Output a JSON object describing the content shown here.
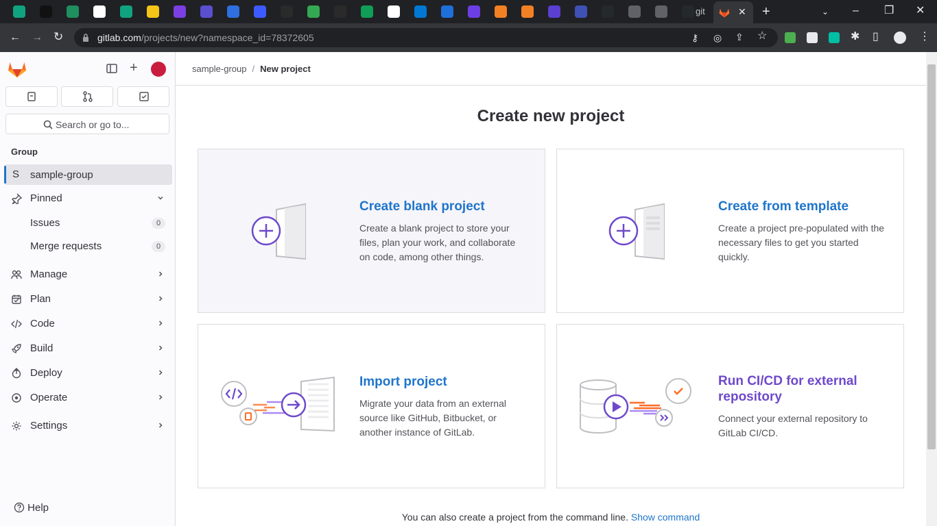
{
  "browser": {
    "url_domain": "gitlab.com",
    "url_path": "/projects/new?namespace_id=78372605",
    "active_tab_title": "git",
    "tab_colors": [
      "#10a37f",
      "#111111",
      "#1f8f5f",
      "#ffffff",
      "#10a37f",
      "#f5c518",
      "#7b3fe4",
      "#5a4fcf",
      "#2f6fdf",
      "#3d5afe",
      "#2a2a2a",
      "#34a853",
      "#2a2a2a",
      "#0f9d58",
      "#ffffff",
      "#0078d4",
      "#1e6fd9",
      "#6b3fe4",
      "#f48024",
      "#f48024",
      "#5b3fd0",
      "#3f51b5",
      "#24292e",
      "#5f6368",
      "#5f6368",
      "#24292e"
    ]
  },
  "sidebar": {
    "search_label": "Search or go to...",
    "group_header": "Group",
    "group": {
      "initial": "S",
      "name": "sample-group"
    },
    "pinned": {
      "label": "Pinned",
      "items": [
        {
          "label": "Issues",
          "count": "0"
        },
        {
          "label": "Merge requests",
          "count": "0"
        }
      ]
    },
    "nav": [
      {
        "label": "Manage",
        "icon": "users-icon"
      },
      {
        "label": "Plan",
        "icon": "calendar-icon"
      },
      {
        "label": "Code",
        "icon": "code-icon"
      },
      {
        "label": "Build",
        "icon": "rocket-icon"
      },
      {
        "label": "Deploy",
        "icon": "deploy-icon"
      },
      {
        "label": "Operate",
        "icon": "operate-icon"
      },
      {
        "label": "Settings",
        "icon": "settings-icon"
      }
    ],
    "help_label": "Help"
  },
  "breadcrumb": {
    "parent": "sample-group",
    "current": "New project"
  },
  "page": {
    "title": "Create new project",
    "cards": [
      {
        "title": "Create blank project",
        "desc": [
          "Create a blank project to store your",
          "files, plan your work, and collaborate",
          "on code, among other things."
        ]
      },
      {
        "title": "Create from template",
        "desc": [
          "Create a project pre-populated with the",
          "necessary files to get you started",
          "quickly."
        ]
      },
      {
        "title": "Import project",
        "desc": [
          "Migrate your data from an external",
          "source like GitHub, Bitbucket, or",
          "another instance of GitLab."
        ]
      },
      {
        "title": [
          "Run CI/CD for external",
          "repository"
        ],
        "desc": [
          "Connect your external repository to",
          "GitLab CI/CD."
        ]
      }
    ],
    "footer_text": "You can also create a project from the command line.",
    "footer_link": "Show command"
  },
  "colors": {
    "brand_orange": "#fc6d26",
    "link_blue": "#1f75cb",
    "purple": "#6e49cb"
  }
}
